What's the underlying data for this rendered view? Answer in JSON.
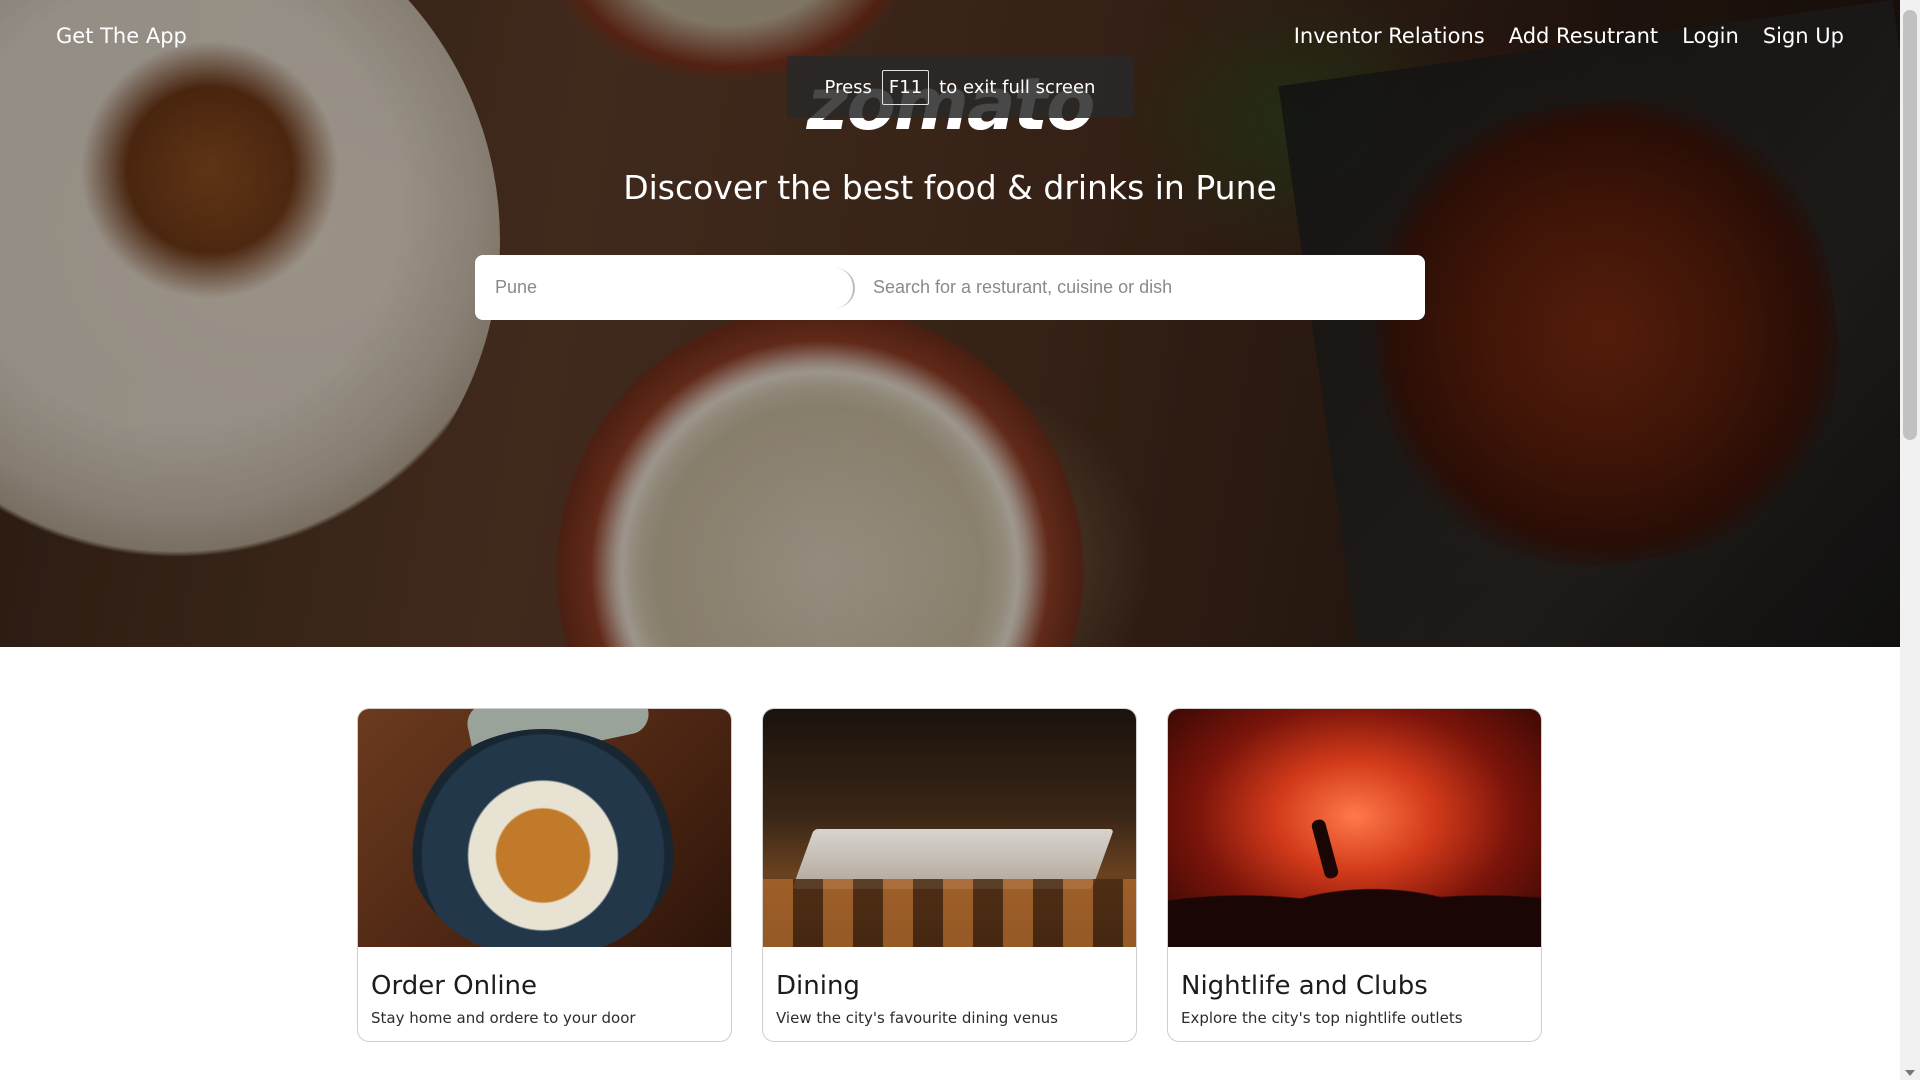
{
  "nav": {
    "get_app": "Get The App",
    "links": [
      "Inventor Relations",
      "Add Resutrant",
      "Login",
      "Sign Up"
    ]
  },
  "hero": {
    "logo": "zomato",
    "tagline": "Discover the best food & drinks in Pune",
    "location_placeholder": "Pune",
    "search_placeholder": "Search for a resturant, cuisine or dish"
  },
  "fullscreen_toast": {
    "press": "Press",
    "key": "F11",
    "rest": "to exit full screen"
  },
  "cards": [
    {
      "title": "Order Online",
      "desc": "Stay home and ordere to your door"
    },
    {
      "title": "Dining",
      "desc": "View the city's favourite dining venus"
    },
    {
      "title": "Nightlife and Clubs",
      "desc": "Explore the city's top nightlife outlets"
    }
  ]
}
